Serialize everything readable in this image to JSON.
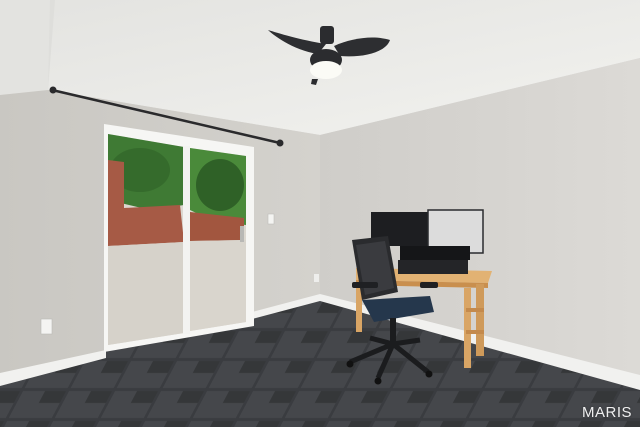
{
  "photo": {
    "subject": "empty-home-office-room",
    "watermark": "MARIS"
  },
  "colors": {
    "ceiling": "#e9e9e6",
    "left_wall": "#d2d0cb",
    "right_wall": "#d8d6d2",
    "floor_tile": "#3c3e42",
    "grout": "#9a9a98",
    "baseboard": "#f3f3f1",
    "desk_wood": "#d9a565",
    "chair": "#2a2b2e",
    "monitor": "#1d1e21",
    "foliage": "#3f7a34",
    "brick": "#a65a45",
    "patio": "#d9d5cd"
  },
  "icons": {
    "ceiling_fan": "ceiling-fan-icon",
    "curtain_rod": "curtain-rod",
    "outlet": "wall-outlet"
  }
}
